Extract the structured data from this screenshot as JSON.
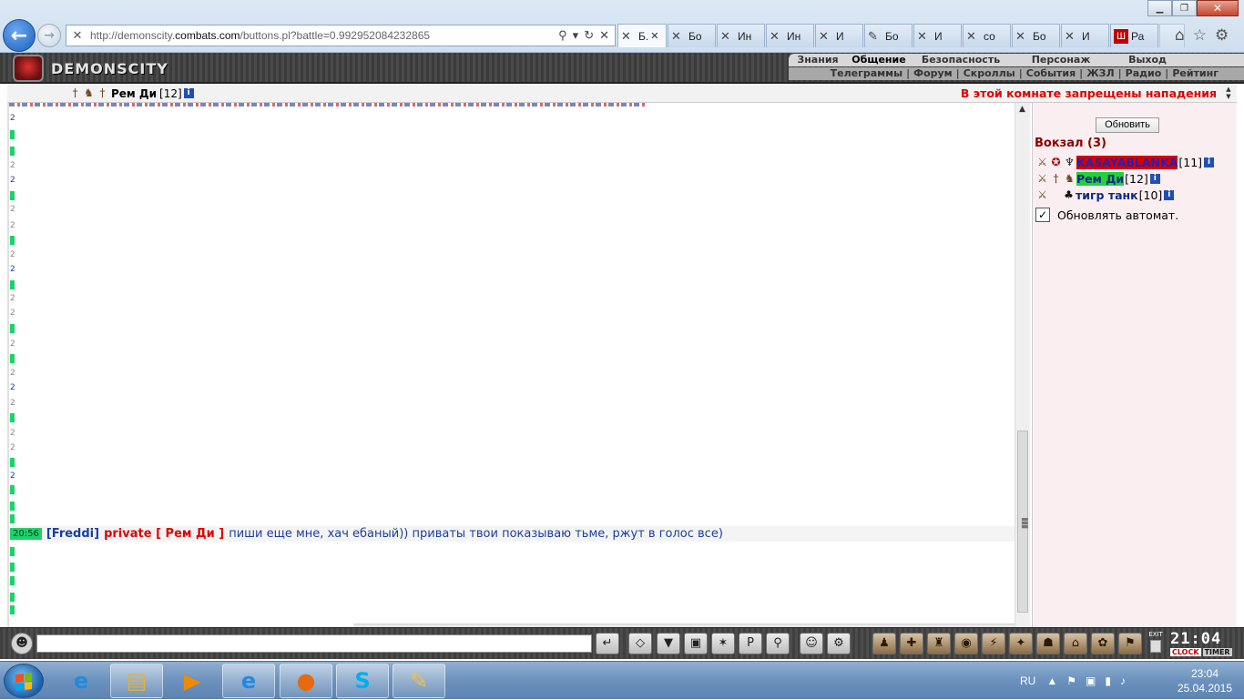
{
  "browser": {
    "url_prefix": "http://demonscity.",
    "url_domain": "combats.com",
    "url_suffix": "/buttons.pl?battle=0.992952084232865",
    "tabs": [
      {
        "label": "Б.",
        "icon": "crossed-swords-icon",
        "active": true,
        "closable": true
      },
      {
        "label": "Бо",
        "icon": "crossed-swords-icon"
      },
      {
        "label": "Ин",
        "icon": "crossed-swords-icon"
      },
      {
        "label": "Ин",
        "icon": "crossed-swords-icon"
      },
      {
        "label": "И",
        "icon": "crossed-swords-icon"
      },
      {
        "label": "Бо",
        "icon": "pen-icon"
      },
      {
        "label": "И",
        "icon": "crossed-swords-icon"
      },
      {
        "label": "со",
        "icon": "crossed-swords-icon"
      },
      {
        "label": "Бо",
        "icon": "crossed-swords-icon"
      },
      {
        "label": "И",
        "icon": "crossed-swords-icon"
      },
      {
        "label": "Ра",
        "icon": "red-logo-icon"
      }
    ]
  },
  "game": {
    "logo_text": "DEMONSCITY",
    "menu_main": [
      "Знания",
      "Общение",
      "Безопасность",
      "Персонаж",
      "Выход"
    ],
    "menu_active": "Общение",
    "menu_sub": [
      "Телеграммы",
      "Форум",
      "Скроллы",
      "События",
      "ЖЗЛ",
      "Радио",
      "Рейтинг"
    ]
  },
  "status": {
    "nick": "Рем Ди",
    "level": "[12]",
    "info": "i",
    "no_attack_notice": "В этой комнате запрещены нападения"
  },
  "chat": {
    "message": {
      "time": "20:56",
      "sender": "Freddi",
      "private_label": "private [ Рем Ди ]",
      "text": "пиши еще мне, хач ебаный)) приваты твои показываю тьме, ржут в голос все)"
    }
  },
  "room": {
    "refresh_label": "Обновить",
    "title": "Вокзал (3)",
    "users": [
      {
        "name": "KASAYABLANKA",
        "level": "[11]",
        "name_color": "#2a1fb0",
        "bg": "#d40000"
      },
      {
        "name": "Рем Ди",
        "level": "[12]",
        "name_color": "#0a2a8a",
        "bg": "#22d23a"
      },
      {
        "name": "тигр танк",
        "level": "[10]",
        "name_color": "#0a2a8a",
        "bg": ""
      }
    ],
    "auto_refresh_label": "Обновлять автомат.",
    "auto_refresh_checked": "✓"
  },
  "clock": {
    "time": "21:04",
    "clock_label": "CLOCK",
    "timer_label": "TIMER",
    "exit_label": "EXIT"
  },
  "taskbar": {
    "lang": "RU",
    "time": "23:04",
    "date": "25.04.2015"
  }
}
